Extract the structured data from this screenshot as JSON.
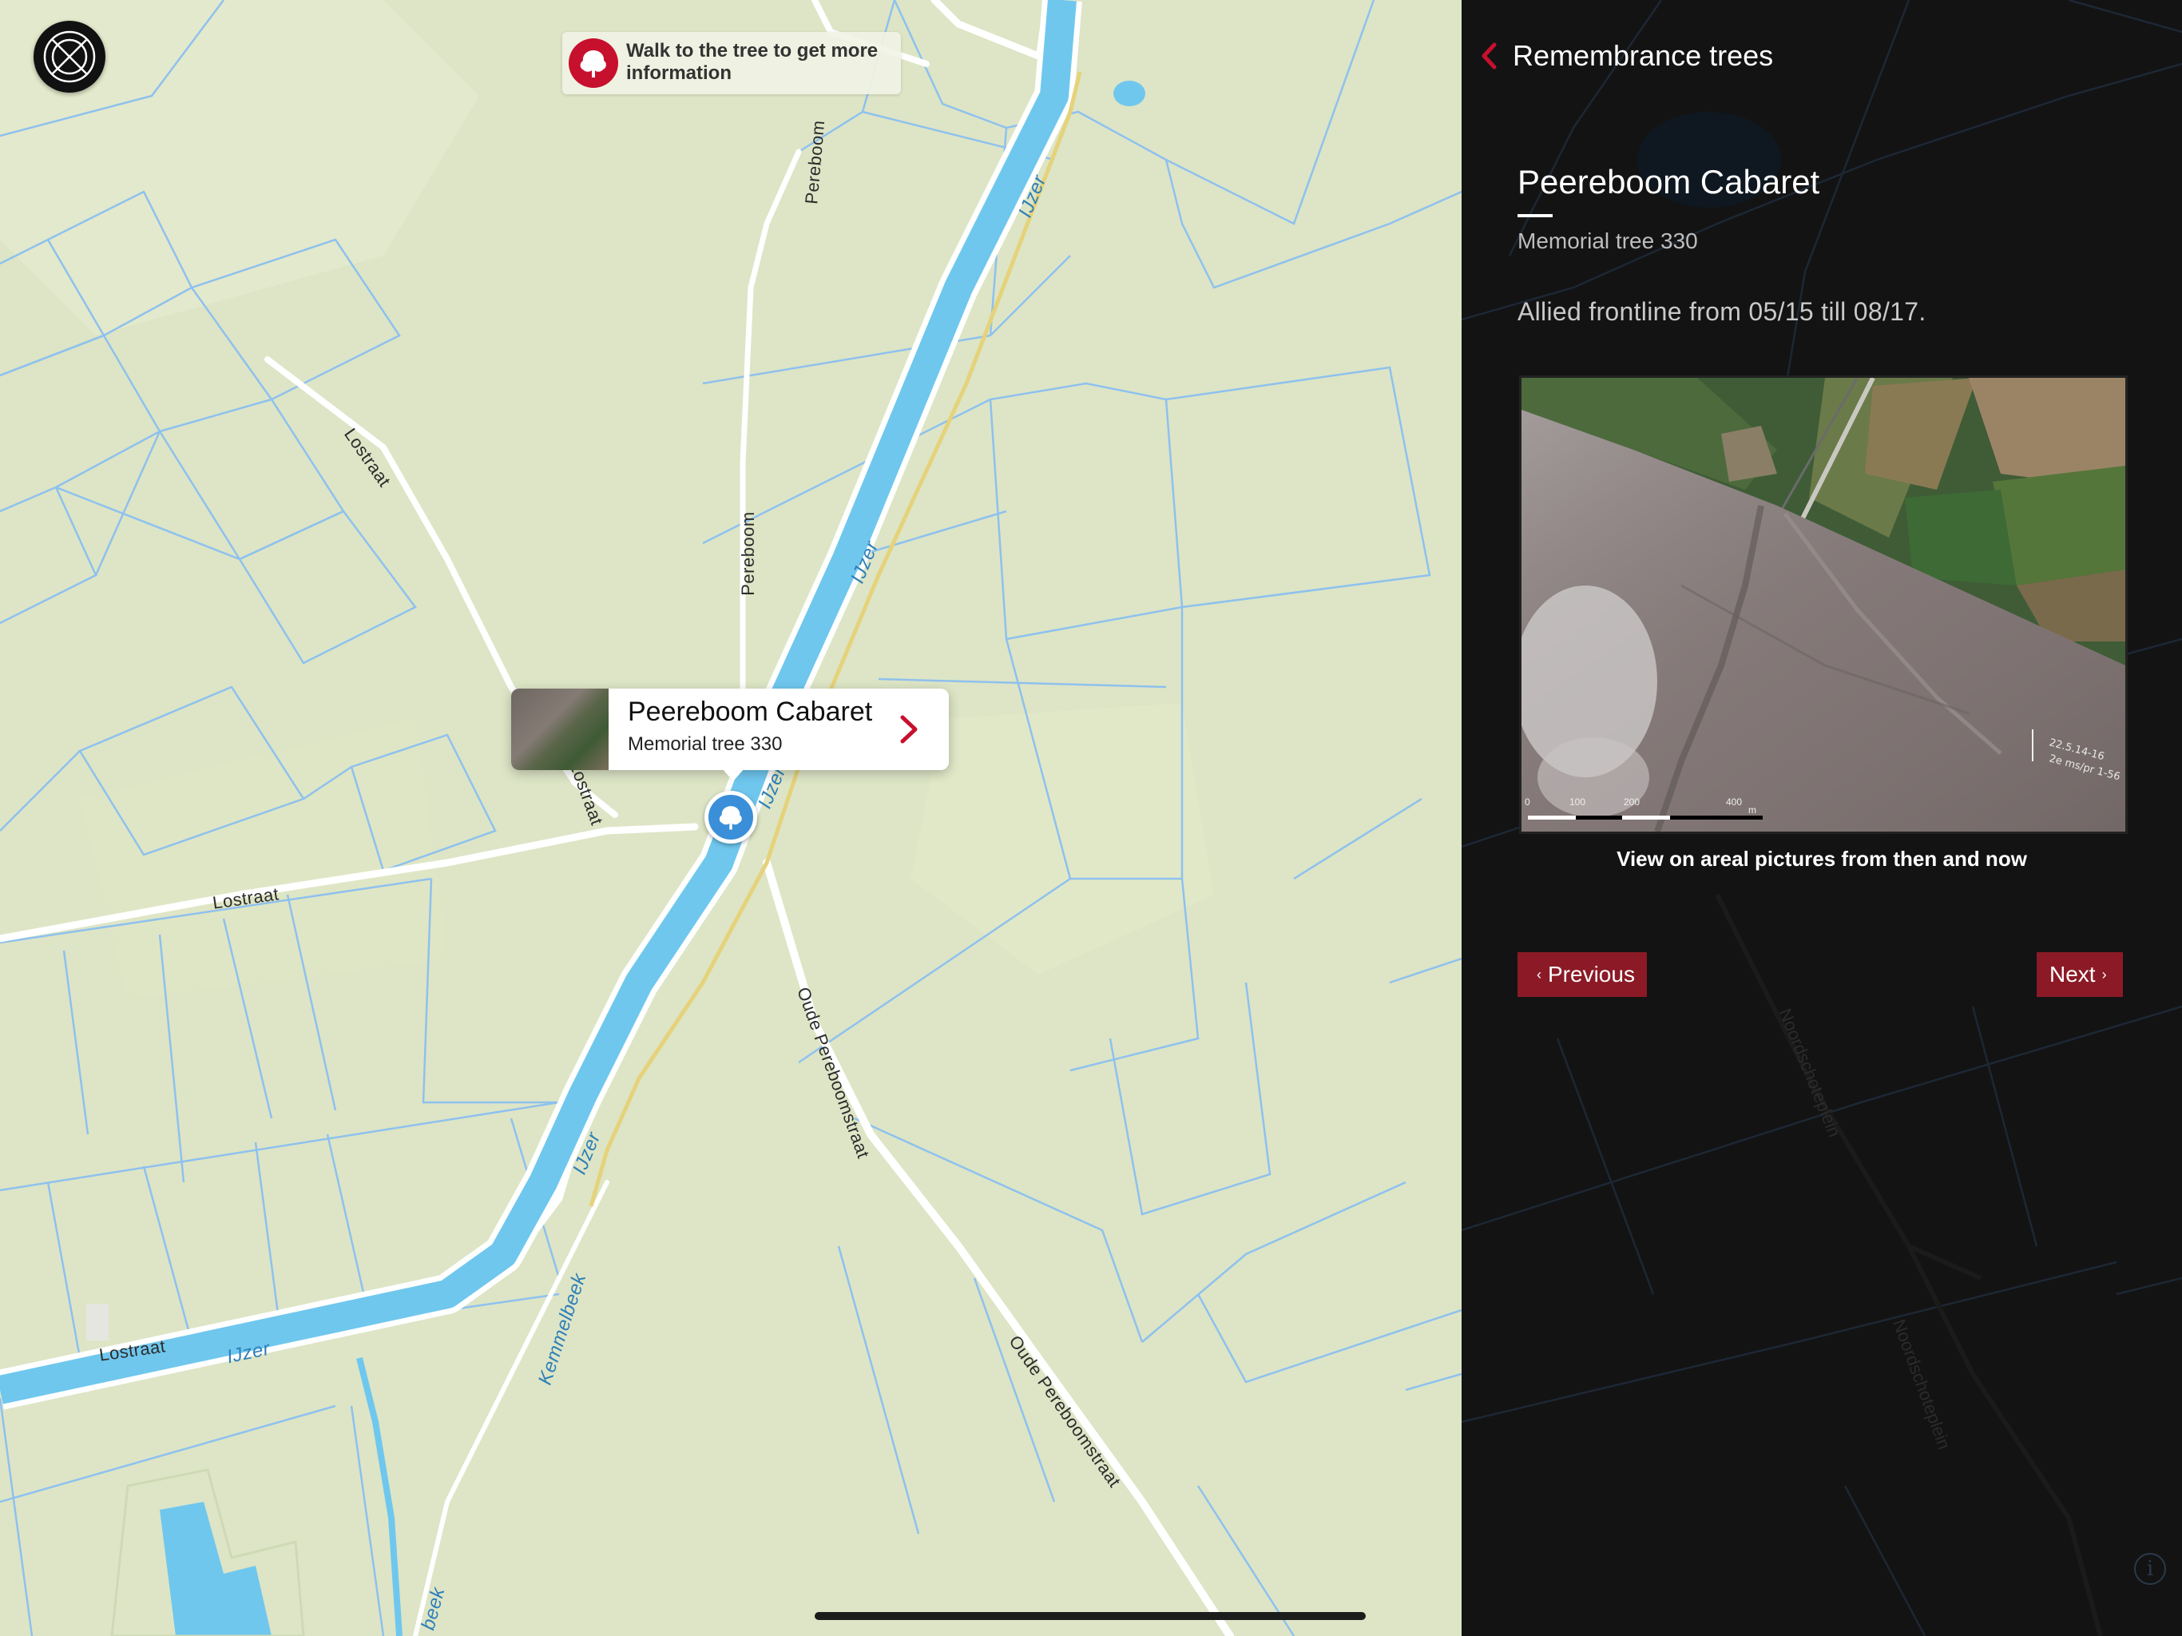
{
  "map": {
    "hint": {
      "text": "Walk to the tree to get more information",
      "icon": "tree-icon"
    },
    "compass_icon": "compass-icon",
    "street_labels": {
      "lostraat_1": "Lostraat",
      "lostraat_2": "Lostraat",
      "lostraat_3": "Lostraat",
      "lostraat_4": "Lostraat",
      "pereboom_1": "Pereboom",
      "pereboom_2": "Pereboom",
      "oude_1": "Oude Pereboomstraat",
      "oude_2": "Oude Pereboomstraat",
      "kemmelbeek_1": "Kemmelbeek",
      "kemmelbeek_2": "beek",
      "noordschote_1": "Noordschoteplein",
      "noordschote_2": "Noordschoteplein"
    },
    "river_labels": {
      "ijzer_1": "IJzer",
      "ijzer_2": "IJzer",
      "ijzer_3": "IJzer",
      "ijzer_4": "IJzer",
      "ijzer_5": "IJzer"
    },
    "callout": {
      "title": "Peereboom Cabaret",
      "subtitle": "Memorial tree 330"
    },
    "colors": {
      "land": "#dde5c6",
      "water": "#6fc7ee",
      "ditch": "#7fb6e6",
      "road": "#ffffff",
      "pin": "#3a8fd8",
      "accent": "#c7102e"
    }
  },
  "panel": {
    "back_label": "Remembrance trees",
    "title": "Peereboom Cabaret",
    "subtitle": "Memorial tree 330",
    "description": "Allied frontline from 05/15 till 08/17.",
    "image_caption": "View on areal pictures from then and now",
    "scale_labels": [
      "0",
      "100",
      "200",
      "400",
      "m"
    ],
    "previous_label": "Previous",
    "next_label": "Next",
    "info_label": "i",
    "colors": {
      "background": "#131313",
      "button": "#8b1a26",
      "text": "#ffffff"
    }
  }
}
